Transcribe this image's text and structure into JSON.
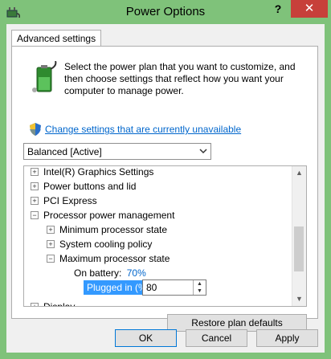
{
  "window": {
    "title": "Power Options",
    "help_label": "?",
    "close_label": "✕"
  },
  "tab": {
    "label": "Advanced settings"
  },
  "description": "Select the power plan that you want to customize, and then choose settings that reflect how you want your computer to manage power.",
  "change_link": "Change settings that are currently unavailable",
  "plan_select": {
    "value": "Balanced [Active]"
  },
  "tree": {
    "items": [
      {
        "label": "Intel(R) Graphics Settings",
        "expander": "+"
      },
      {
        "label": "Power buttons and lid",
        "expander": "+"
      },
      {
        "label": "PCI Express",
        "expander": "+"
      },
      {
        "label": "Processor power management",
        "expander": "−"
      },
      {
        "label": "Minimum processor state",
        "expander": "+"
      },
      {
        "label": "System cooling policy",
        "expander": "+"
      },
      {
        "label": "Maximum processor state",
        "expander": "−"
      },
      {
        "label": "Display",
        "expander": "+"
      }
    ],
    "on_battery_label": "On battery:",
    "on_battery_value": "70%",
    "plugged_in_label": "Plugged in (%):",
    "plugged_in_value": "80"
  },
  "buttons": {
    "restore": "Restore plan defaults",
    "ok": "OK",
    "cancel": "Cancel",
    "apply": "Apply"
  },
  "icons": {
    "app": "power-plug-icon",
    "battery": "battery-icon",
    "shield": "uac-shield-icon"
  },
  "colors": {
    "titlebar": "#7fc27a",
    "close": "#c7403a",
    "link": "#0066cc",
    "selection": "#3399ff"
  }
}
